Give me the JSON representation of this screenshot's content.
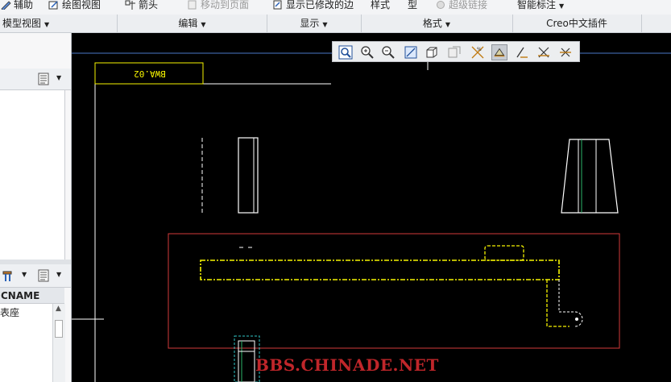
{
  "ribbon": {
    "buttons": [
      {
        "label": "辅助",
        "icon": "pencil-icon"
      },
      {
        "label": "绘图视图",
        "icon": "drawing-view-icon"
      },
      {
        "label": "箭头",
        "icon": "arrow-icon"
      },
      {
        "label": "移动到页面",
        "icon": "move-to-sheet-icon"
      },
      {
        "label": "显示已修改的边",
        "icon": "modified-edges-icon"
      },
      {
        "label": "样式",
        "icon": ""
      },
      {
        "label": "型",
        "icon": ""
      },
      {
        "label": "超级链接",
        "icon": "hyperlink-icon"
      },
      {
        "label": "智能标注",
        "icon": ""
      }
    ],
    "groups": [
      {
        "label": "模型视图"
      },
      {
        "label": "编辑"
      },
      {
        "label": "显示"
      },
      {
        "label": "格式"
      },
      {
        "label": "Creo中文插件"
      }
    ]
  },
  "left_panel": {
    "column_header": "CNAME",
    "rows": [
      "表座"
    ]
  },
  "canvas": {
    "sheet_label": "BWA.02",
    "watermark": "BBS.CHINADE.NET"
  },
  "view_toolbar": {
    "icons": [
      "refit-icon",
      "zoom-in-icon",
      "zoom-out-icon",
      "repaint-icon",
      "display-style-icon",
      "saved-views-icon",
      "datum-display-icon",
      "annotation-display-icon",
      "datum-axis-icon",
      "datum-point-icon",
      "coordinate-system-icon"
    ]
  },
  "colors": {
    "canvas_bg": "#000000",
    "geometry": "#ffffff",
    "highlight": "#f6f400",
    "border": "#d23a3a",
    "guide": "#4a78c8"
  }
}
